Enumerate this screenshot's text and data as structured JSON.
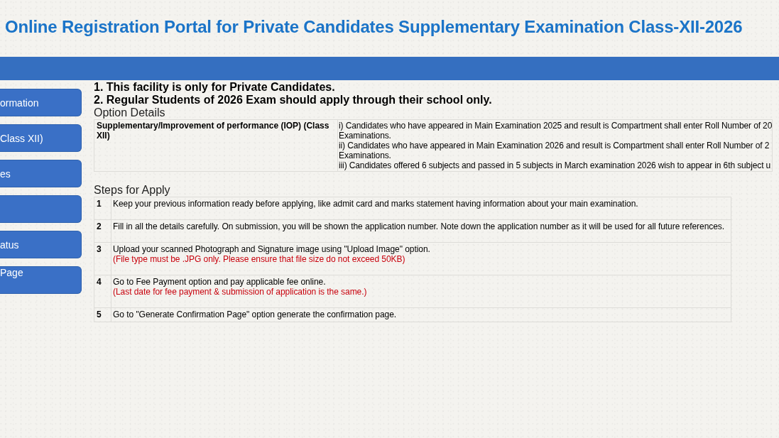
{
  "header": {
    "title": "Online Registration Portal for Private Candidates Supplementary Examination Class-XII-2026"
  },
  "sidebar": {
    "items": [
      {
        "kind": "labeled",
        "label": "ormation"
      },
      {
        "kind": "labeled",
        "label": "Class XII)"
      },
      {
        "kind": "labeled",
        "label": "es"
      },
      {
        "kind": "blank"
      },
      {
        "kind": "labeled",
        "label": "atus"
      },
      {
        "kind": "labeled",
        "label": "Page"
      }
    ]
  },
  "notices": [
    "1. This facility is only for Private Candidates.",
    "2. Regular Students of 2026 Exam should apply through their school only."
  ],
  "option_details": {
    "title": "Option Details",
    "rows": [
      {
        "option": "Supplementary/Improvement of performance (IOP) (Class XII)",
        "details": [
          "i) Candidates who have appeared in Main Examination 2025 and result is Compartment shall enter Roll Number of 20",
          "Examinations.",
          "ii) Candidates who have appeared in Main Examination 2026 and result is Compartment shall enter Roll Number of 2",
          "Examinations.",
          "iii) Candidates offered 6 subjects and passed in 5 subjects in March examination 2026 wish to appear in 6th subject u"
        ]
      }
    ]
  },
  "steps": {
    "title": "Steps for Apply",
    "rows": [
      {
        "number": "1",
        "text": "Keep your previous information ready before applying, like admit card and marks statement having information about your main examination."
      },
      {
        "number": "2",
        "text": "Fill in all the details carefully. On submission, you will be shown the application number. Note down the application number as it will be used for all future references."
      },
      {
        "number": "3",
        "text": "Upload your scanned Photograph and Signature image using \"Upload Image\" option.",
        "note": "(File type must be .JPG only. Please ensure that file size do not exceed 50KB)"
      },
      {
        "number": "4",
        "text": "Go to Fee Payment option and pay applicable fee online.",
        "note": "(Last date for fee payment & submission of application is the same.)"
      },
      {
        "number": "5",
        "text": "Go to \"Generate Confirmation Page\" option generate the confirmation page."
      }
    ]
  }
}
